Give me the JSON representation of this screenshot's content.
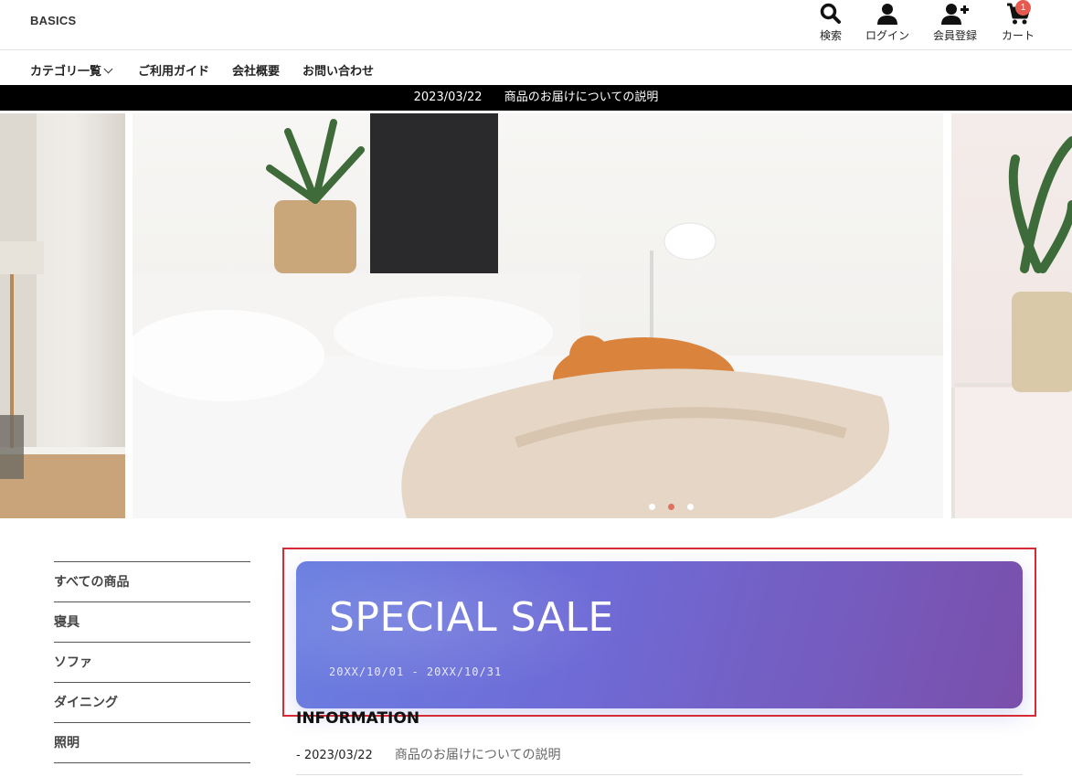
{
  "header": {
    "logo": "BASICS",
    "nav": [
      {
        "label": "検索",
        "icon": "search-icon"
      },
      {
        "label": "ログイン",
        "icon": "user-icon"
      },
      {
        "label": "会員登録",
        "icon": "user-plus-icon"
      },
      {
        "label": "カート",
        "icon": "cart-icon",
        "badge": "1"
      }
    ]
  },
  "category_nav": [
    {
      "label": "カテゴリ一覧"
    },
    {
      "label": "ご利用ガイド"
    },
    {
      "label": "会社概要"
    },
    {
      "label": "お問い合わせ"
    }
  ],
  "notice": {
    "date": "2023/03/22",
    "text": "商品のお届けについての説明"
  },
  "slider": {
    "dot_count": 3,
    "active_index": 1,
    "active_color": "#e07060"
  },
  "sidebar": {
    "items": [
      "すべての商品",
      "寝具",
      "ソファ",
      "ダイニング",
      "照明"
    ]
  },
  "sale_banner": {
    "title": "SPECIAL SALE",
    "dates": "20XX/10/01 - 20XX/10/31"
  },
  "information": {
    "title": "INFORMATION",
    "items": [
      {
        "date": "- 2023/03/22",
        "text": "商品のお届けについての説明"
      }
    ]
  },
  "colors": {
    "badge": "#e55a4f",
    "notice_bg": "#000000",
    "sale_start": "#6a7ee0",
    "sale_end": "#7a4fab",
    "highlight_border": "#d62b34"
  }
}
